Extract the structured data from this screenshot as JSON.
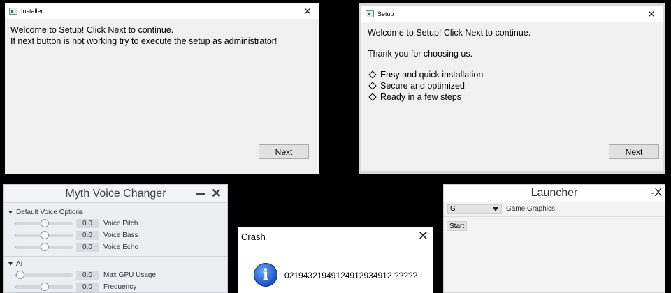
{
  "installer": {
    "title": "Installer",
    "line1": "Welcome to Setup! Click Next to continue.",
    "line2": "If next button is not working try to execute the setup as administrator!",
    "next_label": "Next"
  },
  "setup": {
    "title": "Setup",
    "welcome": "Welcome to Setup! Click Next to continue.",
    "thanks": "Thank you for choosing us.",
    "features": [
      "Easy and quick installation",
      "Secure and optimized",
      "Ready in a few steps"
    ],
    "next_label": "Next"
  },
  "voice_changer": {
    "title": "Myth Voice Changer",
    "sections": [
      {
        "label": "Default Voice Options",
        "rows": [
          {
            "label": "Voice Pitch",
            "value": "0.0",
            "level": 0.5
          },
          {
            "label": "Voice Bass",
            "value": "0.0",
            "level": 0.5
          },
          {
            "label": "Voice Echo",
            "value": "0.0",
            "level": 0.5
          }
        ]
      },
      {
        "label": "AI",
        "rows": [
          {
            "label": "Max GPU Usage",
            "value": "0.0",
            "level": 0.0
          },
          {
            "label": "Frequency",
            "value": "0.0",
            "level": 0.5
          }
        ]
      }
    ]
  },
  "crash": {
    "title": "Crash",
    "message": "0219432194912491293491​2 ?????"
  },
  "launcher": {
    "title": "Launcher",
    "close_label": "-X",
    "select_value": "G",
    "select_label": "Game Graphics",
    "start_label": "Start"
  }
}
